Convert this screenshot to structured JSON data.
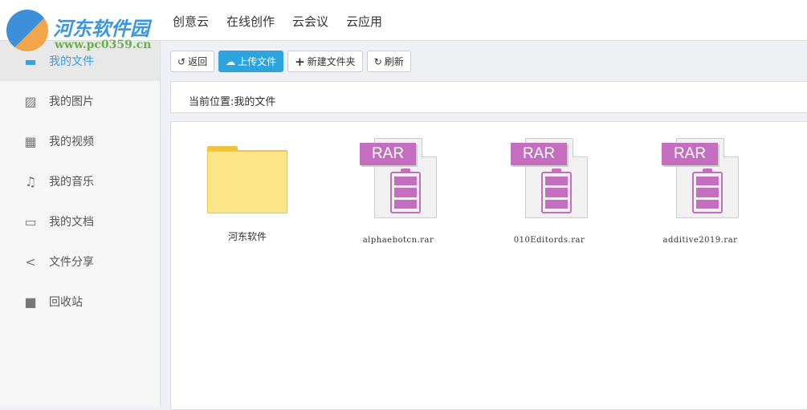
{
  "logo": {
    "name": "河东软件园",
    "url": "www.pc0359.cn"
  },
  "nav": [
    "创意云",
    "在线创作",
    "云会议",
    "云应用"
  ],
  "sidebar": [
    {
      "label": "我的文件",
      "icon": "folder-icon",
      "active": true
    },
    {
      "label": "我的图片",
      "icon": "image-icon"
    },
    {
      "label": "我的视频",
      "icon": "film-icon"
    },
    {
      "label": "我的音乐",
      "icon": "music-icon"
    },
    {
      "label": "我的文档",
      "icon": "inbox-icon"
    },
    {
      "label": "文件分享",
      "icon": "share-icon"
    },
    {
      "label": "回收站",
      "icon": "trash-icon"
    }
  ],
  "toolbar": {
    "back": "返回",
    "upload": "上传文件",
    "new_folder": "新建文件夹",
    "refresh": "刷新"
  },
  "breadcrumb": "当前位置:我的文件",
  "files": [
    {
      "name": "河东软件",
      "type": "folder"
    },
    {
      "name": "alphaebotcn.rar",
      "type": "rar",
      "badge": "RAR"
    },
    {
      "name": "010Editords.rar",
      "type": "rar",
      "badge": "RAR"
    },
    {
      "name": "additive2019.rar",
      "type": "rar",
      "badge": "RAR"
    }
  ],
  "colors": {
    "accent": "#2ea4df",
    "rar": "#c56dbf",
    "folder": "#fbe68a"
  }
}
